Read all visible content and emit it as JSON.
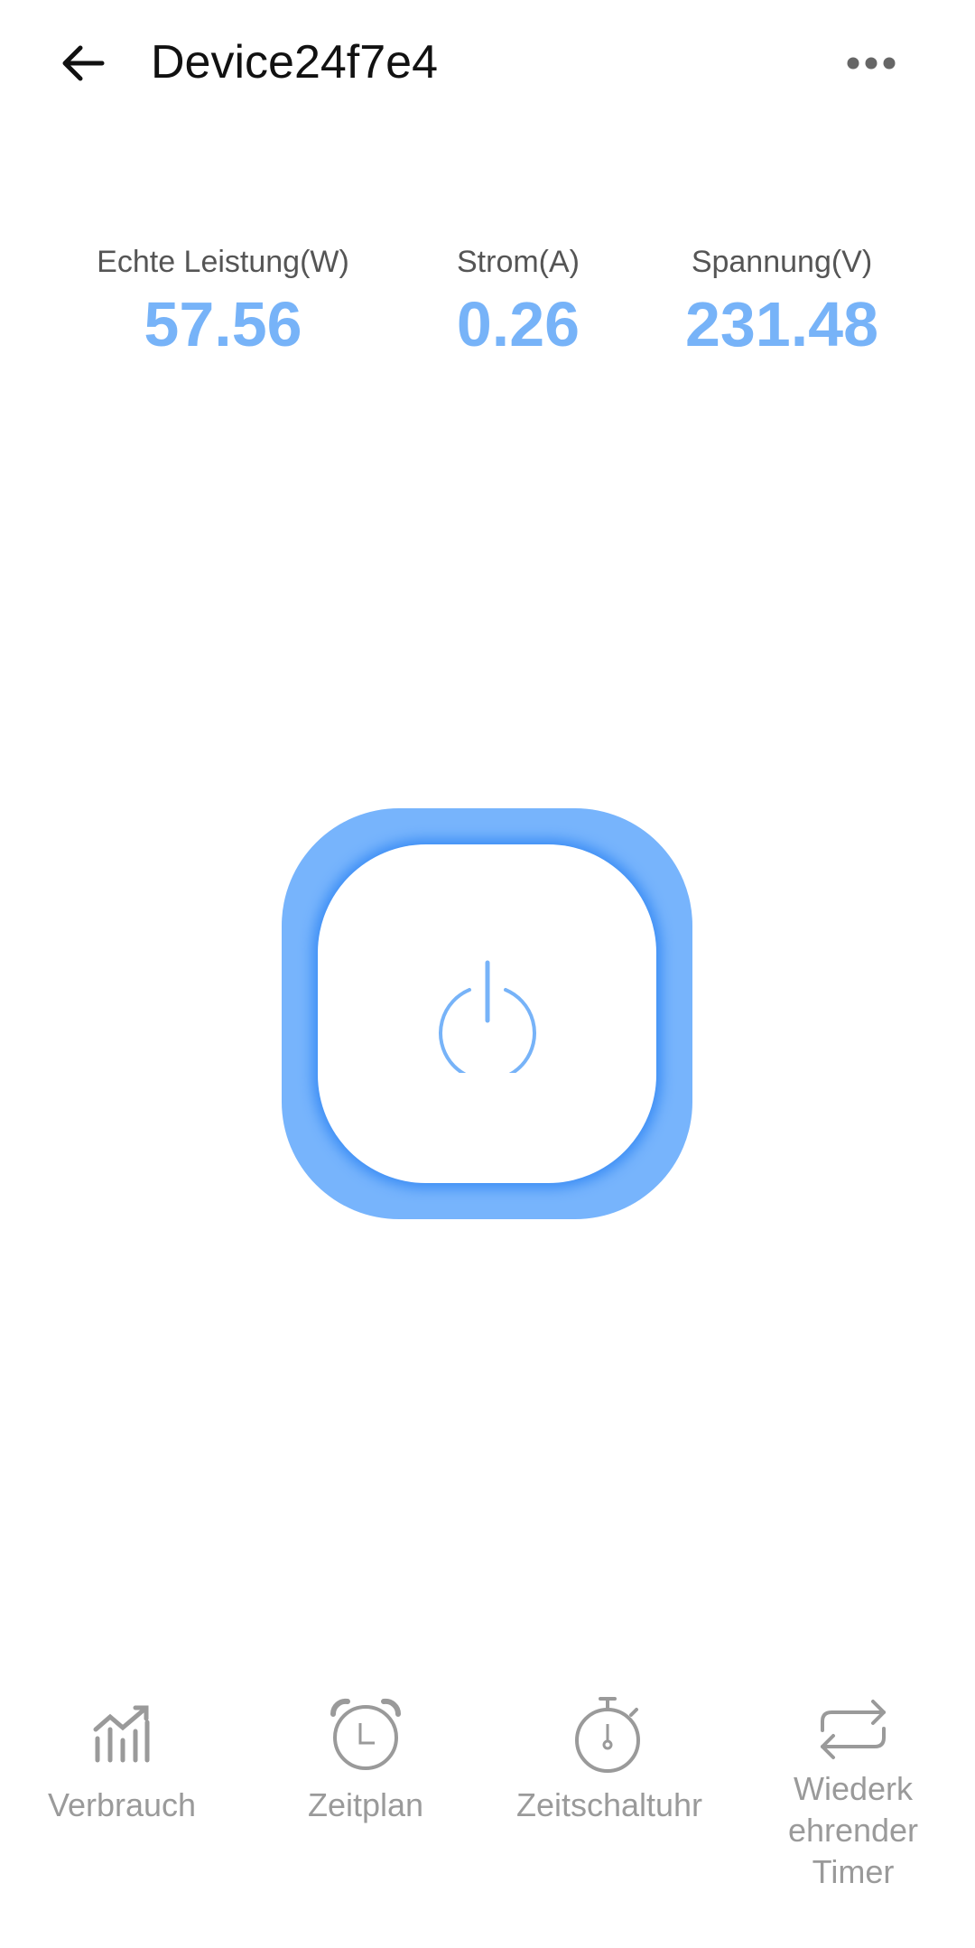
{
  "header": {
    "title": "Device24f7e4",
    "back_icon": "arrow-left-icon",
    "more_icon": "more-horizontal-icon"
  },
  "metrics": [
    {
      "label": "Echte Leistung(W)",
      "value": "57.56"
    },
    {
      "label": "Strom(A)",
      "value": "0.26"
    },
    {
      "label": "Spannung(V)",
      "value": "231.48"
    }
  ],
  "power": {
    "icon": "power-icon",
    "accent_color": "#77b4fc",
    "value_color": "#77b3f8"
  },
  "nav": [
    {
      "label": "Verbrauch",
      "icon": "bar-chart-trend-icon"
    },
    {
      "label": "Zeitplan",
      "icon": "alarm-clock-icon"
    },
    {
      "label": "Zeitschaltuhr",
      "icon": "stopwatch-icon"
    },
    {
      "label_lines": [
        "Wiederk",
        "ehrender",
        "Timer"
      ],
      "icon": "repeat-icon"
    }
  ]
}
